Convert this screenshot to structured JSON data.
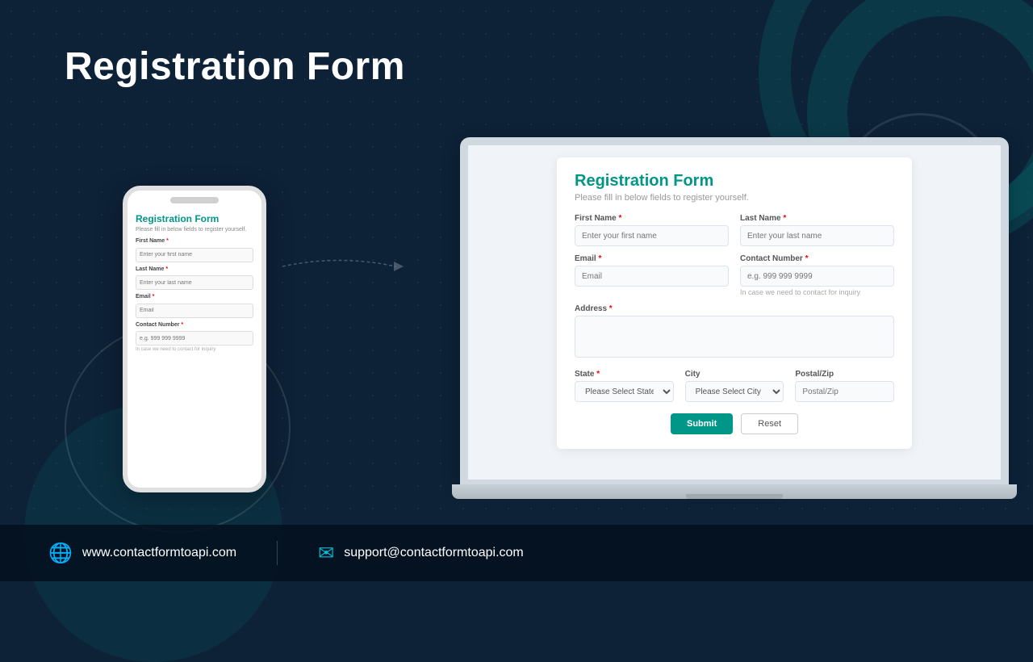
{
  "page": {
    "title": "Registration Form",
    "background_color": "#0d2137"
  },
  "mobile_form": {
    "title": "Registration Form",
    "subtitle": "Please fill in below fields to register yourself.",
    "fields": [
      {
        "label": "First Name",
        "required": true,
        "placeholder": "Enter your first name",
        "type": "text"
      },
      {
        "label": "Last Name",
        "required": true,
        "placeholder": "Enter your last name",
        "type": "text"
      },
      {
        "label": "Email",
        "required": true,
        "placeholder": "Email",
        "type": "email"
      },
      {
        "label": "Contact Number",
        "required": true,
        "placeholder": "e.g. 999 999 9999",
        "type": "tel"
      }
    ],
    "contact_hint": "In case we need to contact for inquiry"
  },
  "laptop_form": {
    "title": "Registration Form",
    "subtitle": "Please fill in below fields to register yourself.",
    "fields": {
      "first_name": {
        "label": "First Name",
        "required": true,
        "placeholder": "Enter your first name"
      },
      "last_name": {
        "label": "Last Name",
        "required": true,
        "placeholder": "Enter your last name"
      },
      "email": {
        "label": "Email",
        "required": true,
        "placeholder": "Email"
      },
      "contact_number": {
        "label": "Contact Number",
        "required": true,
        "placeholder": "e.g. 999 999 9999"
      },
      "address": {
        "label": "Address",
        "required": true,
        "placeholder": ""
      },
      "state": {
        "label": "State",
        "required": true,
        "placeholder": "Please Select State"
      },
      "city": {
        "label": "City",
        "required": false,
        "placeholder": "Please Select City"
      },
      "postal_zip": {
        "label": "Postal/Zip",
        "required": false,
        "placeholder": "Postal/Zip"
      }
    },
    "contact_hint": "In case we need to contact for inquiry",
    "buttons": {
      "submit": "Submit",
      "reset": "Reset"
    }
  },
  "footer": {
    "website": "www.contactformtoapi.com",
    "email": "support@contactformtoapi.com",
    "website_icon": "🌐",
    "email_icon": "✉"
  }
}
